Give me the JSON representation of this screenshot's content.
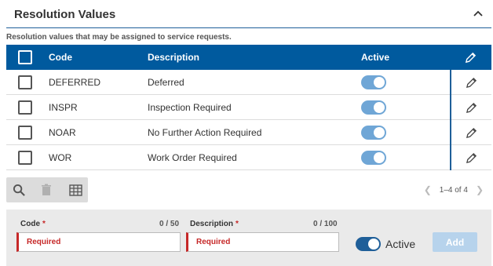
{
  "section": {
    "title": "Resolution Values",
    "subtitle": "Resolution values that may be assigned to service requests."
  },
  "grid": {
    "columns": {
      "code": "Code",
      "description": "Description",
      "active": "Active"
    },
    "rows": [
      {
        "code": "DEFERRED",
        "description": "Deferred",
        "active": true
      },
      {
        "code": "INSPR",
        "description": "Inspection Required",
        "active": true
      },
      {
        "code": "NOAR",
        "description": "No Further Action Required",
        "active": true
      },
      {
        "code": "WOR",
        "description": "Work Order Required",
        "active": true
      }
    ]
  },
  "pager": {
    "range": "1–4 of 4"
  },
  "form": {
    "code": {
      "label": "Code",
      "required_mark": "*",
      "counter": "0 / 50",
      "placeholder": "Required"
    },
    "description": {
      "label": "Description",
      "required_mark": "*",
      "counter": "0 / 100",
      "placeholder": "Required"
    },
    "active_label": "Active",
    "add_label": "Add"
  },
  "icons": {
    "collapse": "chevron-up-icon",
    "edit": "pencil-icon",
    "search": "search-icon",
    "delete": "trash-icon",
    "columns": "grid-icon"
  },
  "colors": {
    "header_bg": "#005a9e",
    "toggle_on": "#6fa6d6",
    "required_red": "#c62828",
    "add_disabled": "#b7d3ec"
  }
}
